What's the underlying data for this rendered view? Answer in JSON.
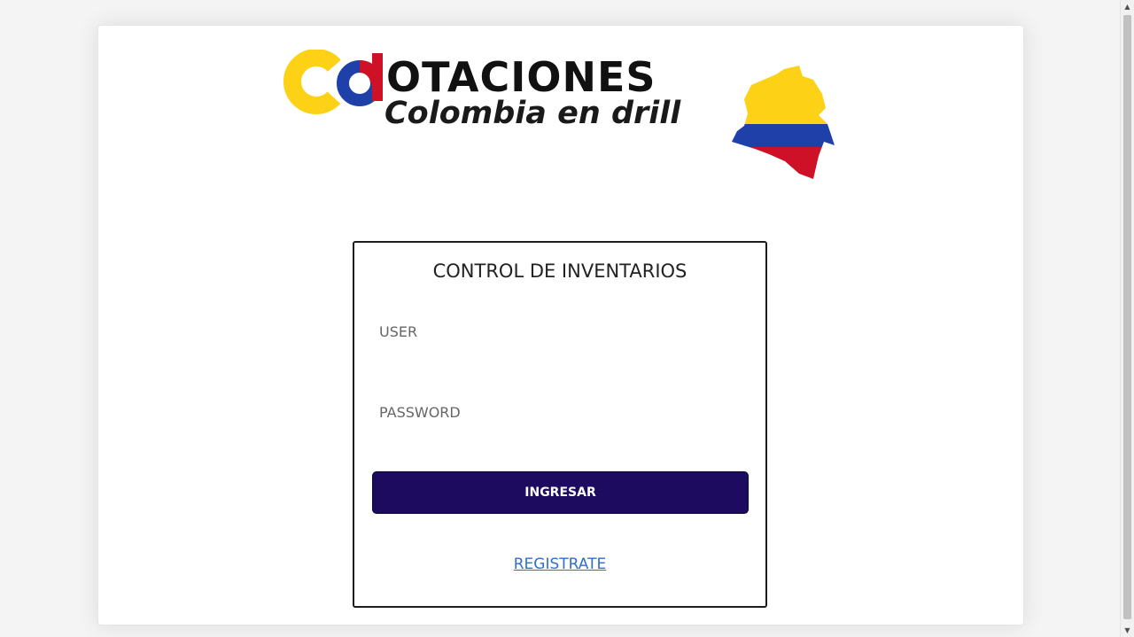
{
  "brand": {
    "title": "OTACIONES",
    "subtitle": "Colombia en drill",
    "colors": {
      "yellow": "#fcd116",
      "blue": "#1e40a8",
      "red": "#ce1126"
    }
  },
  "login": {
    "title": "CONTROL DE INVENTARIOS",
    "user_placeholder": "USER",
    "password_placeholder": "PASSWORD",
    "submit_label": "INGRESAR",
    "register_label": "REGISTRATE"
  },
  "scrollbar": {
    "up_icon": "▲",
    "down_icon": "▼"
  }
}
